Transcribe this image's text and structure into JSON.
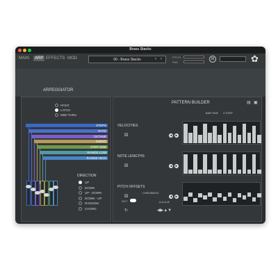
{
  "window": {
    "title": "Brass Stacks",
    "traffic_colors": [
      "#ff5f57",
      "#febc2e",
      "#28c840"
    ]
  },
  "tabs": [
    "MAIN",
    "ARP",
    "EFFECTS",
    "MOD"
  ],
  "active_tab": "ARP",
  "preset": {
    "name": "00 - Brass Stacks",
    "prev": "‹",
    "next": "›"
  },
  "pitch_label": "PITCH",
  "pan_label": "PAN",
  "m_label": "M",
  "gear": "✿",
  "arp": {
    "title": "ARPEGGIATOR",
    "modes": [
      "HOLD",
      "LATCH",
      "MIDI THRU"
    ],
    "selected_mode": "LATCH",
    "params": [
      {
        "label": "STEPS",
        "color": "#3a68c4"
      },
      {
        "label": "RATE",
        "color": "#4a6fd0"
      },
      {
        "label": "OCTAVE",
        "color": "#7b5fc9"
      },
      {
        "label": "SWING",
        "color": "#b59a5a"
      },
      {
        "label": "STEP SIZE",
        "color": "#6d9a4a"
      },
      {
        "label": "RANGE LOW",
        "color": "#4e9aa6"
      },
      {
        "label": "RANGE HIGH",
        "color": "#4a84c6"
      }
    ],
    "slider_levels": [
      0.85,
      0.7,
      0.55,
      0.6,
      0.45,
      0.7,
      0.8
    ],
    "direction_label": "DIRECTION",
    "directions": [
      "UP",
      "DOWN",
      "UP - DOWN",
      "DOWN - UP",
      "RANDOM",
      "CHORD"
    ],
    "selected_direction": "UP"
  },
  "pattern": {
    "title": "PATTERN BUILDER",
    "bar_size_label": "BAR SIZE",
    "bar_size_value": "4 STEP",
    "rows": [
      {
        "label": "VELOCITIES",
        "values": [
          0.9,
          0.5,
          0.8,
          0.4,
          0.9,
          0.5,
          0.8,
          0.4,
          0.9,
          0.5,
          0.8,
          0.4,
          0.9,
          0.5,
          0.8,
          0.4
        ]
      },
      {
        "label": "NOTE LENGTHS",
        "values": [
          0.9,
          0.2,
          0.9,
          0.2,
          0.9,
          0.2,
          0.9,
          0.2,
          0.9,
          0.2,
          0.9,
          0.2,
          0.9,
          0.2,
          0.9,
          0.2
        ]
      },
      {
        "label": "PITCH OFFSETS",
        "values": [
          0.3,
          0.5,
          0.2,
          0.45,
          0.35,
          0.5,
          0.25,
          0.45,
          0.3,
          0.5,
          0.2,
          0.45,
          0.35,
          0.5,
          0.25,
          0.45
        ]
      }
    ],
    "scale": "CHROMATIC",
    "oct_label": "OCT",
    "note_pattern": "A-A-A-B"
  }
}
